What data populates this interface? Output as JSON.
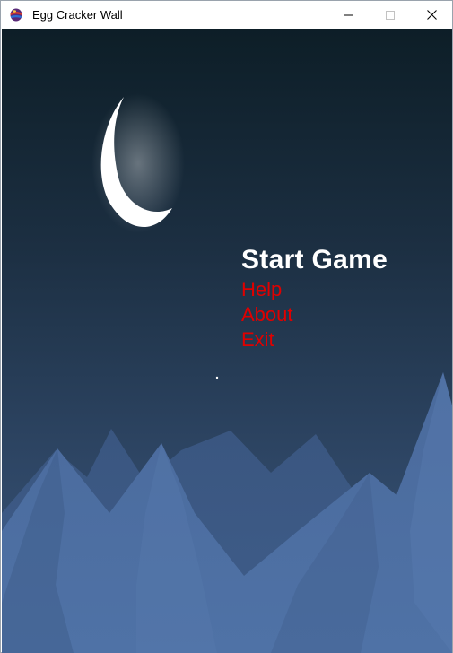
{
  "window": {
    "title": "Egg Cracker Wall",
    "icon": "egg-app-icon",
    "controls": [
      "minimize-icon",
      "maximize-icon",
      "close-icon"
    ]
  },
  "menu": {
    "start_game": "Start Game",
    "help": "Help",
    "about": "About",
    "exit": "Exit"
  },
  "colors": {
    "sky_top": "#0d1e27",
    "sky_bottom": "#3a5579",
    "mountain": "#4d6ea1",
    "moon": "#ffffff",
    "menu_primary": "#ffffff",
    "menu_secondary": "#e00000"
  }
}
